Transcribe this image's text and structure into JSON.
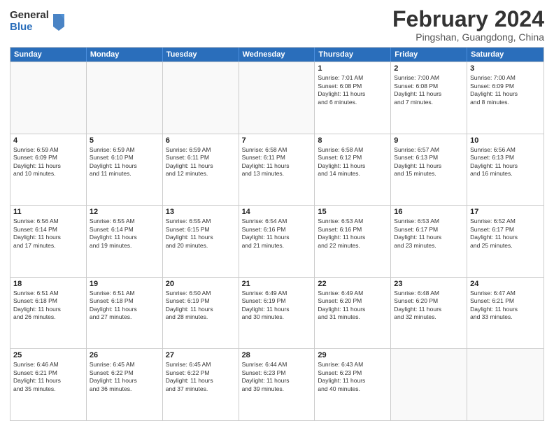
{
  "logo": {
    "general": "General",
    "blue": "Blue"
  },
  "title": {
    "month_year": "February 2024",
    "location": "Pingshan, Guangdong, China"
  },
  "header_days": [
    "Sunday",
    "Monday",
    "Tuesday",
    "Wednesday",
    "Thursday",
    "Friday",
    "Saturday"
  ],
  "weeks": [
    [
      {
        "day": "",
        "info": ""
      },
      {
        "day": "",
        "info": ""
      },
      {
        "day": "",
        "info": ""
      },
      {
        "day": "",
        "info": ""
      },
      {
        "day": "1",
        "info": "Sunrise: 7:01 AM\nSunset: 6:08 PM\nDaylight: 11 hours\nand 6 minutes."
      },
      {
        "day": "2",
        "info": "Sunrise: 7:00 AM\nSunset: 6:08 PM\nDaylight: 11 hours\nand 7 minutes."
      },
      {
        "day": "3",
        "info": "Sunrise: 7:00 AM\nSunset: 6:09 PM\nDaylight: 11 hours\nand 8 minutes."
      }
    ],
    [
      {
        "day": "4",
        "info": "Sunrise: 6:59 AM\nSunset: 6:09 PM\nDaylight: 11 hours\nand 10 minutes."
      },
      {
        "day": "5",
        "info": "Sunrise: 6:59 AM\nSunset: 6:10 PM\nDaylight: 11 hours\nand 11 minutes."
      },
      {
        "day": "6",
        "info": "Sunrise: 6:59 AM\nSunset: 6:11 PM\nDaylight: 11 hours\nand 12 minutes."
      },
      {
        "day": "7",
        "info": "Sunrise: 6:58 AM\nSunset: 6:11 PM\nDaylight: 11 hours\nand 13 minutes."
      },
      {
        "day": "8",
        "info": "Sunrise: 6:58 AM\nSunset: 6:12 PM\nDaylight: 11 hours\nand 14 minutes."
      },
      {
        "day": "9",
        "info": "Sunrise: 6:57 AM\nSunset: 6:13 PM\nDaylight: 11 hours\nand 15 minutes."
      },
      {
        "day": "10",
        "info": "Sunrise: 6:56 AM\nSunset: 6:13 PM\nDaylight: 11 hours\nand 16 minutes."
      }
    ],
    [
      {
        "day": "11",
        "info": "Sunrise: 6:56 AM\nSunset: 6:14 PM\nDaylight: 11 hours\nand 17 minutes."
      },
      {
        "day": "12",
        "info": "Sunrise: 6:55 AM\nSunset: 6:14 PM\nDaylight: 11 hours\nand 19 minutes."
      },
      {
        "day": "13",
        "info": "Sunrise: 6:55 AM\nSunset: 6:15 PM\nDaylight: 11 hours\nand 20 minutes."
      },
      {
        "day": "14",
        "info": "Sunrise: 6:54 AM\nSunset: 6:16 PM\nDaylight: 11 hours\nand 21 minutes."
      },
      {
        "day": "15",
        "info": "Sunrise: 6:53 AM\nSunset: 6:16 PM\nDaylight: 11 hours\nand 22 minutes."
      },
      {
        "day": "16",
        "info": "Sunrise: 6:53 AM\nSunset: 6:17 PM\nDaylight: 11 hours\nand 23 minutes."
      },
      {
        "day": "17",
        "info": "Sunrise: 6:52 AM\nSunset: 6:17 PM\nDaylight: 11 hours\nand 25 minutes."
      }
    ],
    [
      {
        "day": "18",
        "info": "Sunrise: 6:51 AM\nSunset: 6:18 PM\nDaylight: 11 hours\nand 26 minutes."
      },
      {
        "day": "19",
        "info": "Sunrise: 6:51 AM\nSunset: 6:18 PM\nDaylight: 11 hours\nand 27 minutes."
      },
      {
        "day": "20",
        "info": "Sunrise: 6:50 AM\nSunset: 6:19 PM\nDaylight: 11 hours\nand 28 minutes."
      },
      {
        "day": "21",
        "info": "Sunrise: 6:49 AM\nSunset: 6:19 PM\nDaylight: 11 hours\nand 30 minutes."
      },
      {
        "day": "22",
        "info": "Sunrise: 6:49 AM\nSunset: 6:20 PM\nDaylight: 11 hours\nand 31 minutes."
      },
      {
        "day": "23",
        "info": "Sunrise: 6:48 AM\nSunset: 6:20 PM\nDaylight: 11 hours\nand 32 minutes."
      },
      {
        "day": "24",
        "info": "Sunrise: 6:47 AM\nSunset: 6:21 PM\nDaylight: 11 hours\nand 33 minutes."
      }
    ],
    [
      {
        "day": "25",
        "info": "Sunrise: 6:46 AM\nSunset: 6:21 PM\nDaylight: 11 hours\nand 35 minutes."
      },
      {
        "day": "26",
        "info": "Sunrise: 6:45 AM\nSunset: 6:22 PM\nDaylight: 11 hours\nand 36 minutes."
      },
      {
        "day": "27",
        "info": "Sunrise: 6:45 AM\nSunset: 6:22 PM\nDaylight: 11 hours\nand 37 minutes."
      },
      {
        "day": "28",
        "info": "Sunrise: 6:44 AM\nSunset: 6:23 PM\nDaylight: 11 hours\nand 39 minutes."
      },
      {
        "day": "29",
        "info": "Sunrise: 6:43 AM\nSunset: 6:23 PM\nDaylight: 11 hours\nand 40 minutes."
      },
      {
        "day": "",
        "info": ""
      },
      {
        "day": "",
        "info": ""
      }
    ]
  ]
}
